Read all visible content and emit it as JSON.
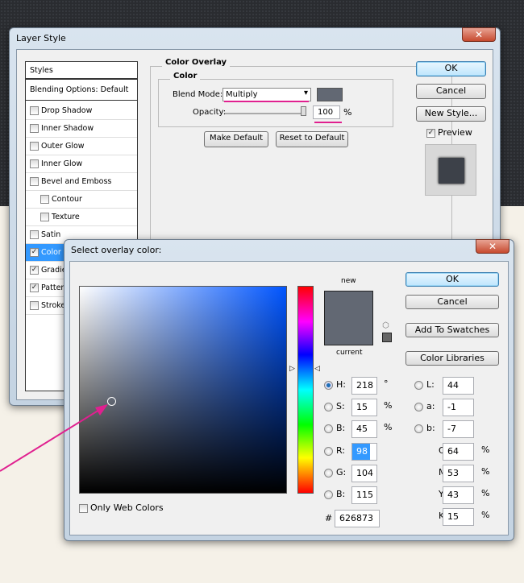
{
  "layer_style": {
    "title": "Layer Style",
    "styles_header": "Styles",
    "blending": "Blending Options: Default",
    "items": [
      {
        "label": "Drop Shadow",
        "checked": false
      },
      {
        "label": "Inner Shadow",
        "checked": false
      },
      {
        "label": "Outer Glow",
        "checked": false
      },
      {
        "label": "Inner Glow",
        "checked": false
      },
      {
        "label": "Bevel and Emboss",
        "checked": false
      },
      {
        "label": "Contour",
        "checked": false
      },
      {
        "label": "Texture",
        "checked": false
      },
      {
        "label": "Satin",
        "checked": false
      },
      {
        "label": "Color Overlay",
        "checked": true
      },
      {
        "label": "Gradient Overlay",
        "checked": true
      },
      {
        "label": "Pattern Overlay",
        "checked": true
      },
      {
        "label": "Stroke",
        "checked": false
      }
    ],
    "group_title": "Color Overlay",
    "sub_title": "Color",
    "blend_label": "Blend Mode:",
    "blend_value": "Multiply",
    "opacity_label": "Opacity:",
    "opacity_value": "100",
    "percent": "%",
    "make_default": "Make Default",
    "reset_default": "Reset to Default",
    "ok": "OK",
    "cancel": "Cancel",
    "new_style": "New Style...",
    "preview": "Preview",
    "overlay_color": "#626873"
  },
  "picker": {
    "title": "Select overlay color:",
    "ok": "OK",
    "cancel": "Cancel",
    "add_swatches": "Add To Swatches",
    "libraries": "Color Libraries",
    "new": "new",
    "current": "current",
    "only_web": "Only Web Colors",
    "fields": {
      "H": {
        "label": "H:",
        "value": "218",
        "unit": "°"
      },
      "S": {
        "label": "S:",
        "value": "15",
        "unit": "%"
      },
      "Bv": {
        "label": "B:",
        "value": "45",
        "unit": "%"
      },
      "R": {
        "label": "R:",
        "value": "98"
      },
      "G": {
        "label": "G:",
        "value": "104"
      },
      "Bl": {
        "label": "B:",
        "value": "115"
      },
      "L": {
        "label": "L:",
        "value": "44"
      },
      "a": {
        "label": "a:",
        "value": "-1"
      },
      "b": {
        "label": "b:",
        "value": "-7"
      },
      "C": {
        "label": "C:",
        "value": "64",
        "unit": "%"
      },
      "M": {
        "label": "M:",
        "value": "53",
        "unit": "%"
      },
      "Y": {
        "label": "Y:",
        "value": "43",
        "unit": "%"
      },
      "K": {
        "label": "K:",
        "value": "15",
        "unit": "%"
      }
    },
    "hash": "#",
    "hex": "626873",
    "hue_color": "#0055ff"
  }
}
